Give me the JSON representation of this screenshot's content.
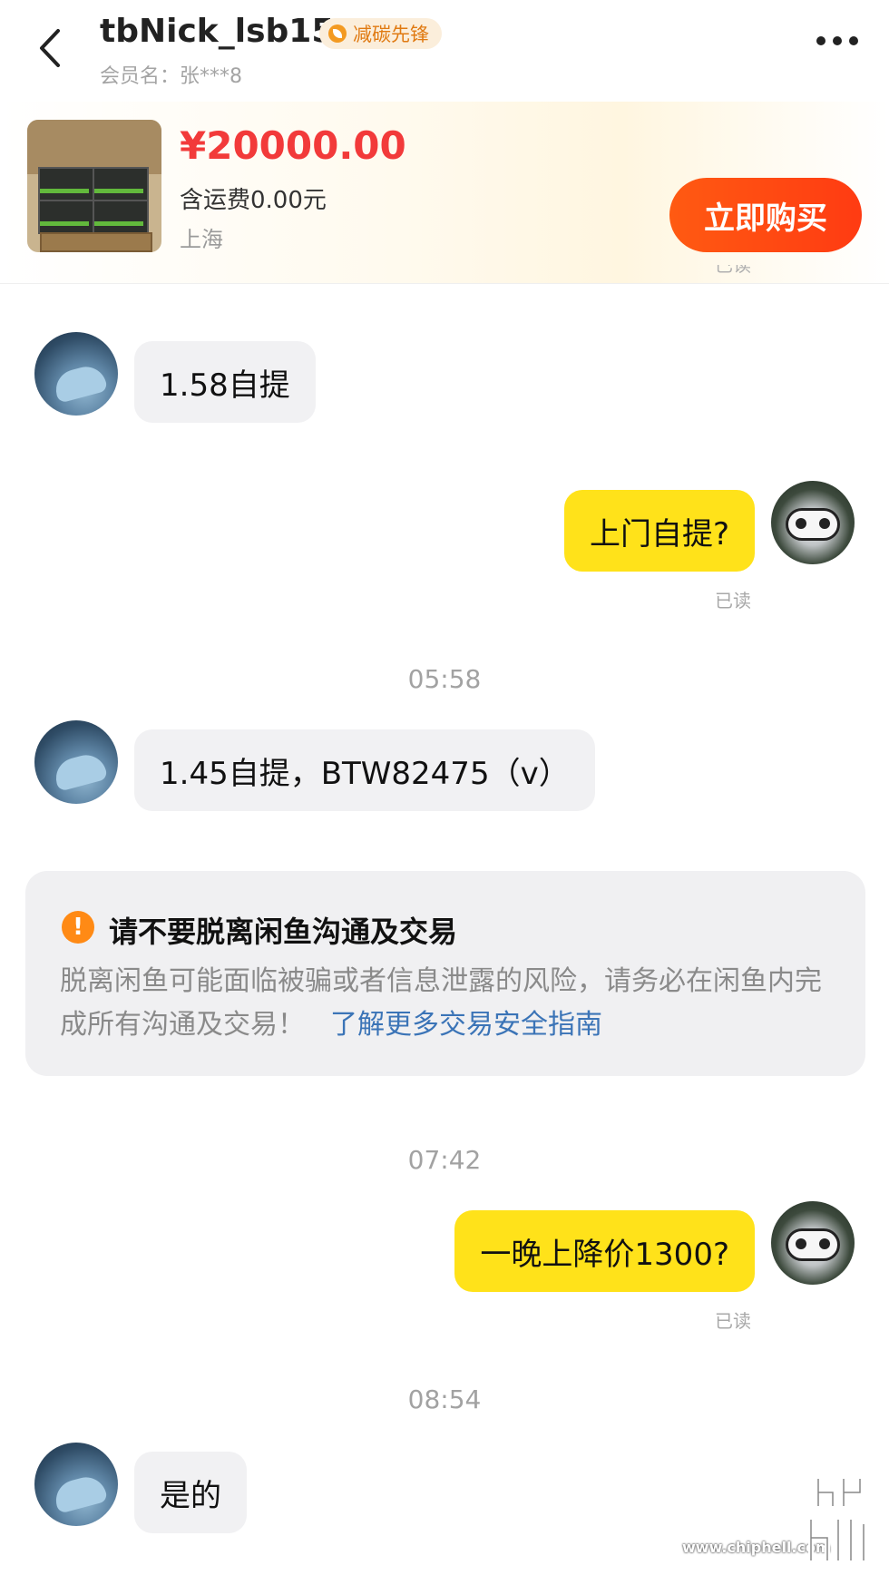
{
  "header": {
    "title": "tbNick_lsb15",
    "badge": "减碳先锋",
    "member_name": "会员名：张***8"
  },
  "product": {
    "price": "¥20000.00",
    "shipping": "含运费0.00元",
    "location": "上海",
    "buy_label": "立即购买",
    "cut_read": "已读"
  },
  "messages": [
    {
      "side": "left",
      "text": "1.58自提"
    },
    {
      "side": "right",
      "text": "上门自提?",
      "status": "已读"
    },
    {
      "time": "05:58"
    },
    {
      "side": "left",
      "text": "1.45自提，BTW82475（v）"
    },
    {
      "time": "07:42"
    },
    {
      "side": "right",
      "text": "一晚上降价1300?",
      "status": "已读"
    },
    {
      "time": "08:54"
    },
    {
      "side": "left",
      "text": "是的"
    }
  ],
  "notice": {
    "title": "请不要脱离闲鱼沟通及交易",
    "body": "脱离闲鱼可能面临被骗或者信息泄露的风险，请务必在闲鱼内完成所有沟通及交易！",
    "link": "了解更多交易安全指南"
  },
  "watermark": {
    "site": "www.chiphell.com"
  },
  "colors": {
    "price": "#f23a3a",
    "buy_button": "#ff4a12",
    "bubble_self": "#ffe21a",
    "bubble_other": "#f1f1f3",
    "link": "#3b74b7",
    "warning_icon": "#ff8a15"
  },
  "icons": [
    "back-arrow-icon",
    "leaf-icon",
    "more-dots-icon",
    "warning-icon"
  ]
}
